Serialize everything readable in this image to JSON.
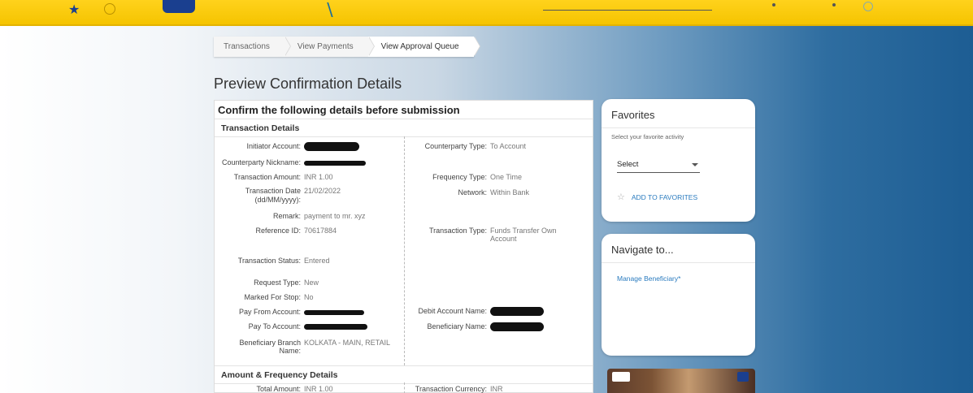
{
  "breadcrumb": [
    "Transactions",
    "View Payments",
    "View Approval Queue"
  ],
  "page_title": "Preview Confirmation Details",
  "card_header": "Confirm the following details before submission",
  "section1_title": "Transaction Details",
  "section2_title": "Amount & Frequency Details",
  "left_fields": {
    "initiator_account": {
      "label": "Initiator Account:"
    },
    "counterparty_nickname": {
      "label": "Counterparty Nickname:"
    },
    "transaction_amount": {
      "label": "Transaction Amount:",
      "value": "INR 1.00"
    },
    "transaction_date": {
      "label": "Transaction Date (dd/MM/yyyy):",
      "value": "21/02/2022"
    },
    "remark": {
      "label": "Remark:",
      "value": "payment to mr. xyz"
    },
    "reference_id": {
      "label": "Reference ID:",
      "value": "70617884"
    },
    "transaction_status": {
      "label": "Transaction Status:",
      "value": "Entered"
    },
    "request_type": {
      "label": "Request Type:",
      "value": "New"
    },
    "marked_for_stop": {
      "label": "Marked For Stop:",
      "value": "No"
    },
    "pay_from_account": {
      "label": "Pay From Account:"
    },
    "pay_to_account": {
      "label": "Pay To Account:"
    },
    "beneficiary_branch_name": {
      "label": "Beneficiary Branch Name:",
      "value": "KOLKATA - MAIN, RETAIL"
    }
  },
  "right_fields": {
    "counterparty_type": {
      "label": "Counterparty Type:",
      "value": "To Account"
    },
    "frequency_type": {
      "label": "Frequency Type:",
      "value": "One Time"
    },
    "network": {
      "label": "Network:",
      "value": "Within Bank"
    },
    "transaction_type": {
      "label": "Transaction Type:",
      "value": "Funds Transfer Own Account"
    },
    "debit_account_name": {
      "label": "Debit Account Name:"
    },
    "beneficiary_name": {
      "label": "Beneficiary Name:"
    }
  },
  "amount_section": {
    "total_amount": {
      "label": "Total Amount:",
      "value": "INR 1.00"
    },
    "transaction_currency": {
      "label": "Transaction Currency:",
      "value": "INR"
    }
  },
  "favorites": {
    "title": "Favorites",
    "subtitle": "Select your favorite activity",
    "select_value": "Select",
    "add_label": "ADD TO FAVORITES"
  },
  "navigate": {
    "title": "Navigate to...",
    "link": "Manage Beneficiary*"
  }
}
